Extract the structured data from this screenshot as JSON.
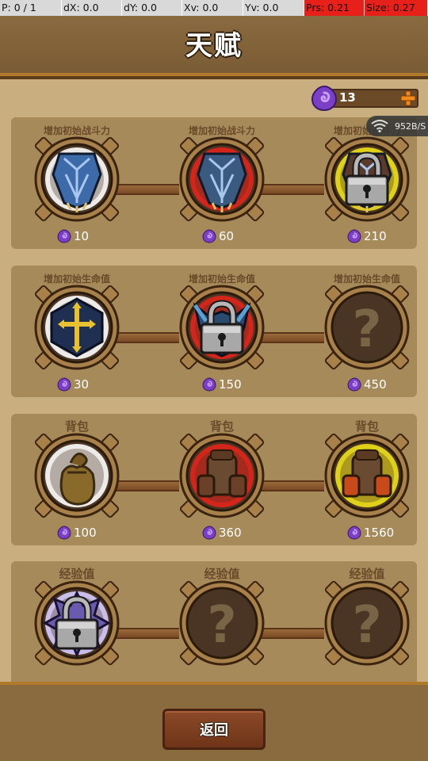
{
  "debug": {
    "pointer": "P: 0 / 1",
    "dx": "dX: 0.0",
    "dy": "dY: 0.0",
    "xv": "Xv: 0.0",
    "yv": "Yv: 0.0",
    "prs": "Prs: 0.21",
    "size": "Size: 0.27"
  },
  "header": {
    "title": "天赋"
  },
  "currency": {
    "value": "13"
  },
  "network": {
    "speed": "952B/S"
  },
  "talent_rows": [
    {
      "talents": [
        {
          "label": "增加初始战斗力",
          "cost": "10",
          "art": "shield-blue",
          "state": "unlocked"
        },
        {
          "label": "增加初始战斗力",
          "cost": "60",
          "art": "shield-red",
          "state": "unlocked"
        },
        {
          "label": "增加初始战斗力",
          "cost": "210",
          "art": "shield-gold",
          "state": "locked"
        }
      ]
    },
    {
      "talents": [
        {
          "label": "增加初始生命值",
          "cost": "30",
          "art": "cross-shield",
          "state": "unlocked"
        },
        {
          "label": "增加初始生命值",
          "cost": "150",
          "art": "horned-shield",
          "state": "locked"
        },
        {
          "label": "增加初始生命值",
          "cost": "450",
          "art": "unknown",
          "state": "unknown"
        }
      ]
    },
    {
      "talents": [
        {
          "label": "背包",
          "cost": "100",
          "art": "sack",
          "state": "unlocked"
        },
        {
          "label": "背包",
          "cost": "360",
          "art": "backpack-red",
          "state": "unlocked"
        },
        {
          "label": "背包",
          "cost": "1560",
          "art": "backpack-gold",
          "state": "unlocked"
        }
      ]
    },
    {
      "talents": [
        {
          "label": "经验值",
          "art": "xp-purple",
          "state": "locked"
        },
        {
          "label": "经验值",
          "art": "unknown",
          "state": "unknown"
        },
        {
          "label": "经验值",
          "art": "unknown",
          "state": "unknown"
        }
      ]
    }
  ],
  "footer": {
    "back_label": "返回"
  },
  "colors": {
    "panel": "#c9ae80",
    "row": "#a78a5a",
    "label": "#6a4a2a",
    "glow_white": "#ffffff",
    "glow_red": "#e3241b",
    "glow_gold": "#f0e21a",
    "gem": "#7b3fc6"
  }
}
